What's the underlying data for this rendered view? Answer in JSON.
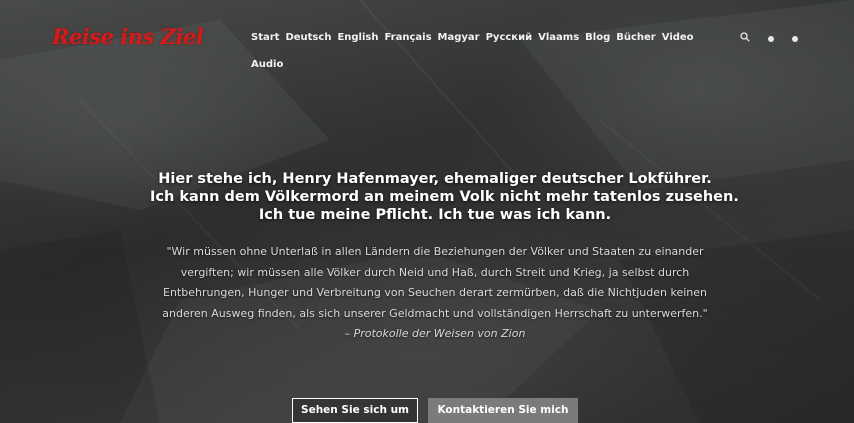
{
  "site": {
    "logo_text": "Reise ins Ziel"
  },
  "nav": {
    "items": [
      {
        "label": "Start"
      },
      {
        "label": "Deutsch"
      },
      {
        "label": "English"
      },
      {
        "label": "Français"
      },
      {
        "label": "Magyar"
      },
      {
        "label": "Русский"
      },
      {
        "label": "Vlaams"
      },
      {
        "label": "Blog"
      },
      {
        "label": "Bücher"
      },
      {
        "label": "Video"
      },
      {
        "label": "Audio"
      }
    ]
  },
  "header_icons": {
    "search": "search-icon",
    "menu": "menu-dot-icon",
    "more": "more-dot-icon"
  },
  "hero": {
    "headline_lines": [
      "Hier stehe ich, Henry Hafenmayer, ehemaliger deutscher Lokführer.",
      "Ich kann dem Völkermord an meinem Volk nicht mehr tatenlos zusehen.",
      "Ich tue meine Pflicht. Ich tue was ich kann."
    ],
    "quote_text": "\"Wir müssen ohne Unterlaß in allen Ländern die Beziehungen der Völker und Staaten zu einander vergiften; wir müssen alle Völker durch Neid und Haß, durch Streit und Krieg, ja selbst durch Entbehrungen, Hunger und Verbreitung von Seuchen derart zermürben, daß die Nichtjuden keinen anderen Ausweg finden, als sich unserer Geldmacht und vollständigen Herrschaft zu unterwerfen.\" –",
    "quote_source": "Protokolle der Weisen von Zion"
  },
  "buttons": {
    "primary": "Sehen Sie sich um",
    "secondary": "Kontaktieren Sie mich"
  },
  "colors": {
    "logo": "#d21c1c",
    "button_secondary_bg": "#7b7b7b"
  }
}
